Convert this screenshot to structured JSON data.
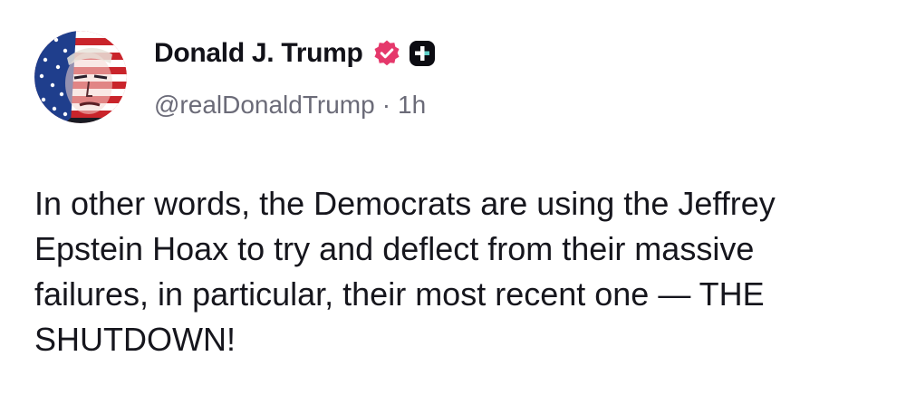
{
  "post": {
    "author": {
      "display_name": "Donald J. Trump",
      "handle": "@realDonaldTrump",
      "verified_icon": "verified-badge-icon",
      "badge_icon": "truth-plus-icon",
      "avatar": "avatar"
    },
    "separator": "·",
    "timestamp": "1h",
    "text": "In other words, the Democrats are using the Jeffrey Epstein Hoax to try and deflect from their massive failures, in particular, their most recent one — THE SHUTDOWN!"
  },
  "colors": {
    "verified_badge": "#e5386b",
    "handle_gray": "#6b6b78",
    "text": "#16161d"
  }
}
